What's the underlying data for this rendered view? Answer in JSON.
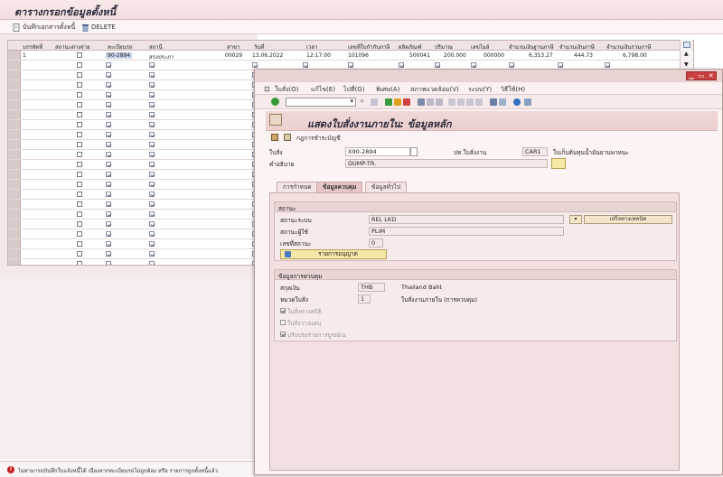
{
  "main": {
    "title": "ตารางกรอกข้อมูลตั้งหนี้",
    "toolbar": {
      "save_label": "บันทึกเอกสารตั้งหนี้",
      "delete_label": "DELETE"
    },
    "columns": [
      "บรรทัดที่",
      "สถานะต่างจ่าย",
      "ทะเบียนรถ",
      "สถานี",
      "สาขา",
      "วันที่",
      "เวลา",
      "เลขที่ใบกำกับภาษี",
      "ผลิตภัณฑ์",
      "ปริมาณ",
      "เลขไมล์",
      "จำนวนเงินฐานภาษี",
      "จำนวนเงินภาษี",
      "จำนวนเงินรวมภาษี"
    ],
    "first_row": {
      "line": "1",
      "plate": "90-2894",
      "station": "สรงประภา",
      "branch": "00029",
      "date": "13.06.2022",
      "time": "12:17:00",
      "tax_invoice": "101096",
      "product": "500041",
      "quantity": "200.000",
      "mileage": "000000",
      "base_amount": "6,353.27",
      "tax_amount": "444.73",
      "total_amount": "6,798.00"
    },
    "status_message": "ไม่สามารถบันทึกใบแจ้งหนี้ได้ เนื่องจากทะเบียนรถไม่ถูกต้อง หรือ รายการถูกตั้งหนี้แล้ว"
  },
  "dialog": {
    "menu": [
      "ใบสั่ง(O)",
      "แก้ไข(E)",
      "ไปที่(G)",
      "พิเศษ(A)",
      "สภาพแวดล้อม(V)",
      "ระบบ(Y)",
      "วิธีใช้(H)"
    ],
    "title": "แสดงใบสั่งงานภายใน: ข้อมูลหลัก",
    "app_toolbar": {
      "rule_label": "กฎการชำระบัญชี"
    },
    "order_label": "ใบสั่ง",
    "order_value": "X90-2894",
    "order_type_label": "ปท.ใบสั่งงาน",
    "order_type_value": "CAR1",
    "order_type_desc": "ใบเก็บต้นทุนน้ำมันยานพาหนะ",
    "desc_label": "คำอธิบาย",
    "desc_value": "DUMP-TR.",
    "tabs": [
      "การกำหนด",
      "ข้อมูลควบคุม",
      "ข้อมูลทั่วไป"
    ],
    "status_group": {
      "header": "สถานะ",
      "system_status_label": "สถานะระบบ",
      "system_status_value": "REL  LKD",
      "user_status_label": "สถานะผู้ใช้",
      "user_status_value": "PLIM",
      "status_no_label": "เลขที่สถานะ",
      "status_no_value": "0",
      "permit_button": "รายการอนุญาต",
      "process_button": "เสร็จทางเทคนิค"
    },
    "control_group": {
      "header": "ข้อมูลการควบคุม",
      "currency_label": "สกุลเงิน",
      "currency_value": "THB",
      "currency_desc": "Thailand Baht",
      "category_label": "หมวดใบสั่ง",
      "category_value": "1",
      "category_desc": "ใบสั่งงานภายใน (การควบคุม)",
      "checks": [
        {
          "label": "ใบสั่งทางสถิติ",
          "checked": true
        },
        {
          "label": "ใบสั่งวางแผน",
          "checked": false
        },
        {
          "label": "ปรับปรุงรายการบูรณ์เน",
          "checked": true
        }
      ]
    }
  },
  "colors": {
    "accent": "#c94040",
    "title_bg": "#f2dede",
    "button_yellow": "#f8e8a8"
  }
}
